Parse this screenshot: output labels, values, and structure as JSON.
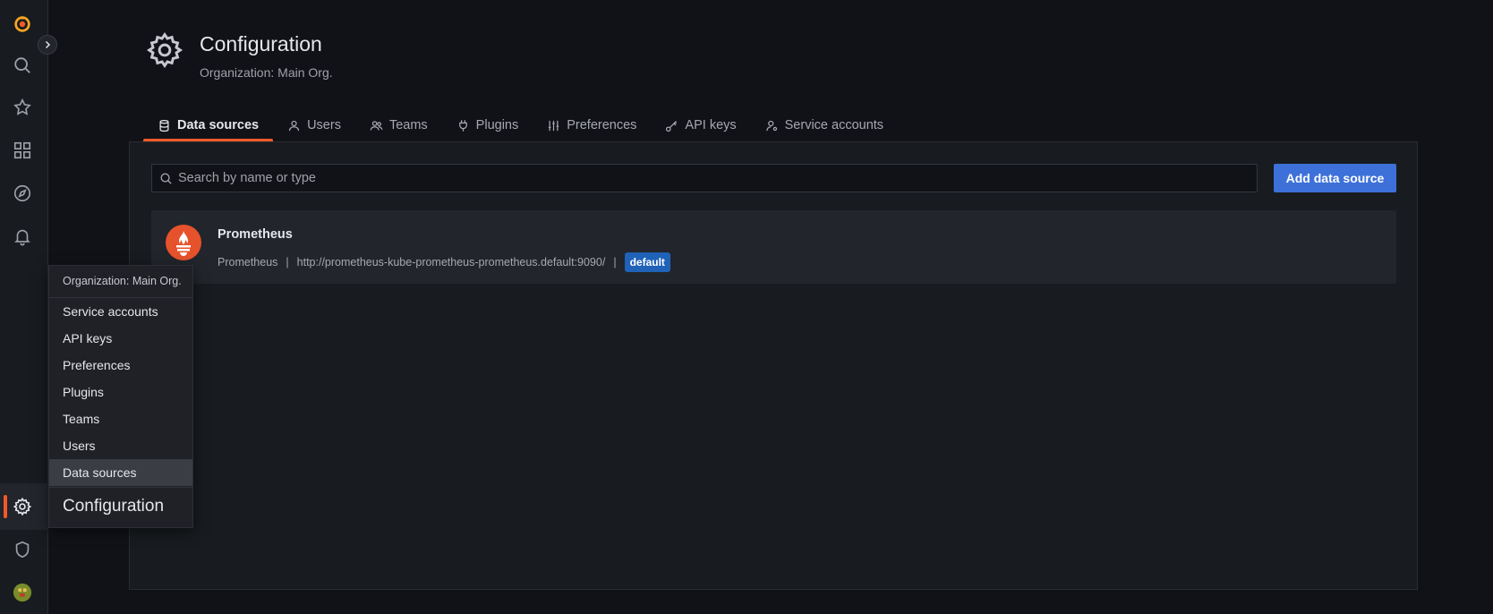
{
  "header": {
    "title": "Configuration",
    "subtitle": "Organization: Main Org."
  },
  "tabs": [
    {
      "label": "Data sources",
      "icon": "database-icon",
      "active": true
    },
    {
      "label": "Users",
      "icon": "user-icon",
      "active": false
    },
    {
      "label": "Teams",
      "icon": "users-icon",
      "active": false
    },
    {
      "label": "Plugins",
      "icon": "plug-icon",
      "active": false
    },
    {
      "label": "Preferences",
      "icon": "sliders-icon",
      "active": false
    },
    {
      "label": "API keys",
      "icon": "key-icon",
      "active": false
    },
    {
      "label": "Service accounts",
      "icon": "user-cog-icon",
      "active": false
    }
  ],
  "search": {
    "placeholder": "Search by name or type"
  },
  "add_button": "Add data source",
  "datasources": [
    {
      "name": "Prometheus",
      "type": "Prometheus",
      "separator": "|",
      "url": "http://prometheus-kube-prometheus-prometheus.default:9090/",
      "badge": "default"
    }
  ],
  "popup": {
    "header": "Organization: Main Org.",
    "items": [
      "Service accounts",
      "API keys",
      "Preferences",
      "Plugins",
      "Teams",
      "Users",
      "Data sources"
    ],
    "selected": "Data sources",
    "title": "Configuration"
  },
  "colors": {
    "accent": "#f05a28",
    "primary_button": "#3d71d9",
    "badge": "#1f62b8",
    "background": "#111217",
    "panel": "#181b1f"
  }
}
